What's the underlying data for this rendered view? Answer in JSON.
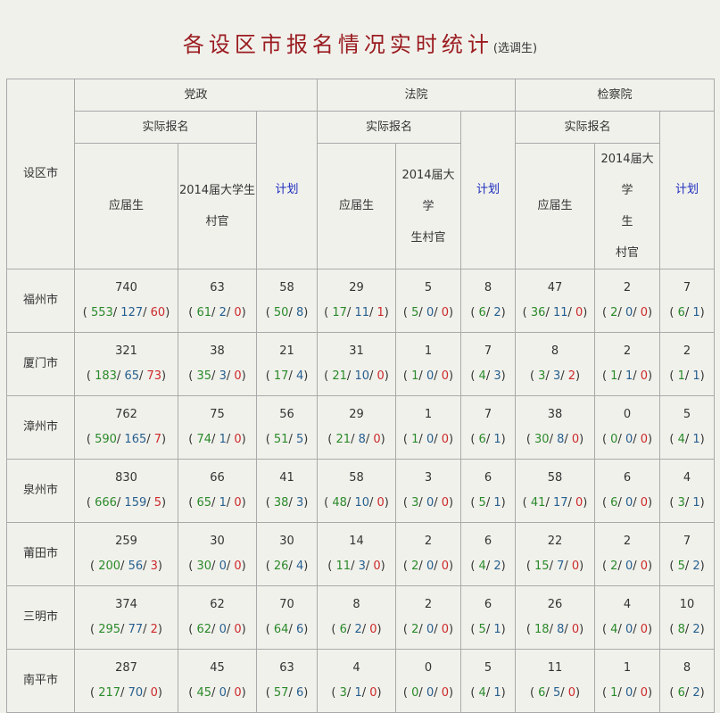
{
  "title": {
    "main": "各设区市报名情况实时统计",
    "sub": "(选调生)"
  },
  "headers": {
    "city": "设区市",
    "groups": [
      "党政",
      "法院",
      "检察院"
    ],
    "actual": "实际报名",
    "fresh": "应届生",
    "village_party": [
      "2014届大学生",
      "村官"
    ],
    "village_court": [
      "2014届大学",
      "生村官"
    ],
    "village_proc": [
      "2014届大学",
      "生",
      "村官"
    ],
    "plan": "计划"
  },
  "rows": [
    {
      "city": "福州市",
      "dz": {
        "fresh": [
          "740",
          "553",
          "127",
          "60"
        ],
        "village": [
          "63",
          "61",
          "2",
          "0"
        ],
        "plan": [
          "58",
          "50",
          "8"
        ]
      },
      "fy": {
        "fresh": [
          "29",
          "17",
          "11",
          "1"
        ],
        "village": [
          "5",
          "5",
          "0",
          "0"
        ],
        "plan": [
          "8",
          "6",
          "2"
        ]
      },
      "jc": {
        "fresh": [
          "47",
          "36",
          "11",
          "0"
        ],
        "village": [
          "2",
          "2",
          "0",
          "0"
        ],
        "plan": [
          "7",
          "6",
          "1"
        ]
      }
    },
    {
      "city": "厦门市",
      "dz": {
        "fresh": [
          "321",
          "183",
          "65",
          "73"
        ],
        "village": [
          "38",
          "35",
          "3",
          "0"
        ],
        "plan": [
          "21",
          "17",
          "4"
        ]
      },
      "fy": {
        "fresh": [
          "31",
          "21",
          "10",
          "0"
        ],
        "village": [
          "1",
          "1",
          "0",
          "0"
        ],
        "plan": [
          "7",
          "4",
          "3"
        ]
      },
      "jc": {
        "fresh": [
          "8",
          "3",
          "3",
          "2"
        ],
        "village": [
          "2",
          "1",
          "1",
          "0"
        ],
        "plan": [
          "2",
          "1",
          "1"
        ]
      }
    },
    {
      "city": "漳州市",
      "dz": {
        "fresh": [
          "762",
          "590",
          "165",
          "7"
        ],
        "village": [
          "75",
          "74",
          "1",
          "0"
        ],
        "plan": [
          "56",
          "51",
          "5"
        ]
      },
      "fy": {
        "fresh": [
          "29",
          "21",
          "8",
          "0"
        ],
        "village": [
          "1",
          "1",
          "0",
          "0"
        ],
        "plan": [
          "7",
          "6",
          "1"
        ]
      },
      "jc": {
        "fresh": [
          "38",
          "30",
          "8",
          "0"
        ],
        "village": [
          "0",
          "0",
          "0",
          "0"
        ],
        "plan": [
          "5",
          "4",
          "1"
        ]
      }
    },
    {
      "city": "泉州市",
      "dz": {
        "fresh": [
          "830",
          "666",
          "159",
          "5"
        ],
        "village": [
          "66",
          "65",
          "1",
          "0"
        ],
        "plan": [
          "41",
          "38",
          "3"
        ]
      },
      "fy": {
        "fresh": [
          "58",
          "48",
          "10",
          "0"
        ],
        "village": [
          "3",
          "3",
          "0",
          "0"
        ],
        "plan": [
          "6",
          "5",
          "1"
        ]
      },
      "jc": {
        "fresh": [
          "58",
          "41",
          "17",
          "0"
        ],
        "village": [
          "6",
          "6",
          "0",
          "0"
        ],
        "plan": [
          "4",
          "3",
          "1"
        ]
      }
    },
    {
      "city": "莆田市",
      "dz": {
        "fresh": [
          "259",
          "200",
          "56",
          "3"
        ],
        "village": [
          "30",
          "30",
          "0",
          "0"
        ],
        "plan": [
          "30",
          "26",
          "4"
        ]
      },
      "fy": {
        "fresh": [
          "14",
          "11",
          "3",
          "0"
        ],
        "village": [
          "2",
          "2",
          "0",
          "0"
        ],
        "plan": [
          "6",
          "4",
          "2"
        ]
      },
      "jc": {
        "fresh": [
          "22",
          "15",
          "7",
          "0"
        ],
        "village": [
          "2",
          "2",
          "0",
          "0"
        ],
        "plan": [
          "7",
          "5",
          "2"
        ]
      }
    },
    {
      "city": "三明市",
      "dz": {
        "fresh": [
          "374",
          "295",
          "77",
          "2"
        ],
        "village": [
          "62",
          "62",
          "0",
          "0"
        ],
        "plan": [
          "70",
          "64",
          "6"
        ]
      },
      "fy": {
        "fresh": [
          "8",
          "6",
          "2",
          "0"
        ],
        "village": [
          "2",
          "2",
          "0",
          "0"
        ],
        "plan": [
          "6",
          "5",
          "1"
        ]
      },
      "jc": {
        "fresh": [
          "26",
          "18",
          "8",
          "0"
        ],
        "village": [
          "4",
          "4",
          "0",
          "0"
        ],
        "plan": [
          "10",
          "8",
          "2"
        ]
      }
    },
    {
      "city": "南平市",
      "dz": {
        "fresh": [
          "287",
          "217",
          "70",
          "0"
        ],
        "village": [
          "45",
          "45",
          "0",
          "0"
        ],
        "plan": [
          "63",
          "57",
          "6"
        ]
      },
      "fy": {
        "fresh": [
          "4",
          "3",
          "1",
          "0"
        ],
        "village": [
          "0",
          "0",
          "0",
          "0"
        ],
        "plan": [
          "5",
          "4",
          "1"
        ]
      },
      "jc": {
        "fresh": [
          "11",
          "6",
          "5",
          "0"
        ],
        "village": [
          "1",
          "1",
          "0",
          "0"
        ],
        "plan": [
          "8",
          "6",
          "2"
        ]
      }
    }
  ],
  "colors": {
    "title": "#9a1c20",
    "plan": "#1b2bbd",
    "green": "#2a8a2a",
    "blue": "#27608f",
    "red": "#cc2a2a"
  }
}
